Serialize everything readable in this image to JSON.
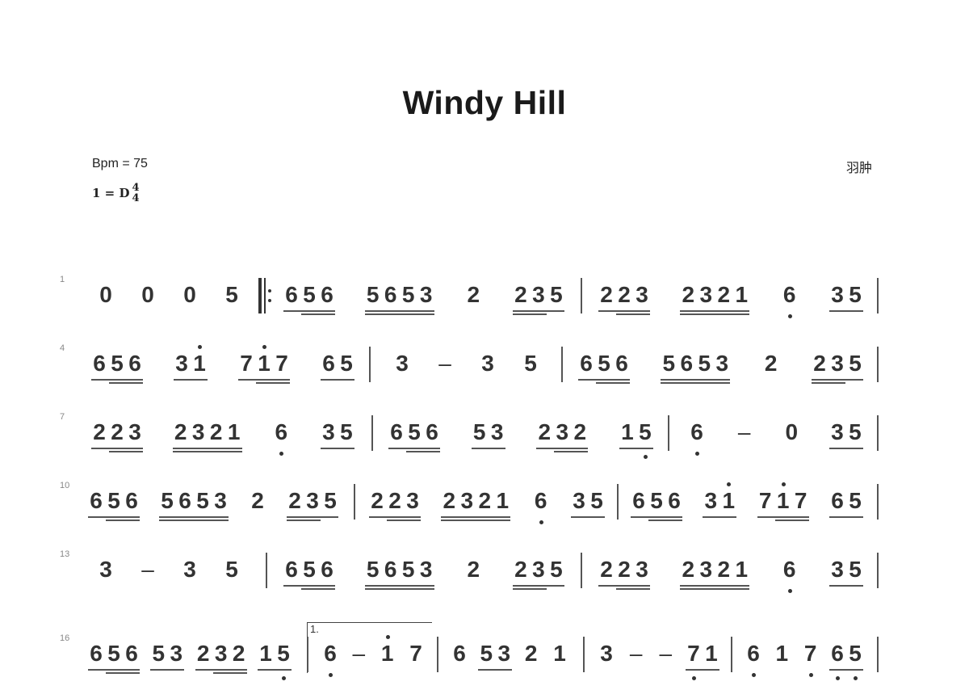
{
  "title": "Windy Hill",
  "bpm_label": "Bpm = 75",
  "key": {
    "prefix": "1 = D",
    "time_top": "4",
    "time_bottom": "4"
  },
  "composer": "羽肿",
  "rows": [
    {
      "measure_number": "1",
      "measures": [
        {
          "groups": [
            [
              {
                "n": "0"
              }
            ],
            [
              {
                "n": "0"
              }
            ],
            [
              {
                "n": "0"
              }
            ],
            [
              {
                "n": "5"
              }
            ]
          ],
          "end": "repeat-start"
        },
        {
          "groups": [
            [
              {
                "n": "6",
                "u": 1
              },
              {
                "n": "5",
                "u": 2
              },
              {
                "n": "6",
                "u": 2
              }
            ],
            [
              {
                "n": "5",
                "u": 2
              },
              {
                "n": "6",
                "u": 2
              },
              {
                "n": "5",
                "u": 2
              },
              {
                "n": "3",
                "u": 2
              }
            ],
            [
              {
                "n": "2"
              }
            ],
            [
              {
                "n": "2",
                "u": 2
              },
              {
                "n": "3",
                "u": 2
              },
              {
                "n": "5",
                "u": 1
              }
            ]
          ],
          "end": "bar"
        },
        {
          "groups": [
            [
              {
                "n": "2",
                "u": 1
              },
              {
                "n": "2",
                "u": 2
              },
              {
                "n": "3",
                "u": 2
              }
            ],
            [
              {
                "n": "2",
                "u": 2
              },
              {
                "n": "3",
                "u": 2
              },
              {
                "n": "2",
                "u": 2
              },
              {
                "n": "1",
                "u": 2
              }
            ],
            [
              {
                "n": "6",
                "dn": true
              }
            ],
            [
              {
                "n": "3",
                "u": 1
              },
              {
                "n": "5",
                "u": 1
              }
            ]
          ],
          "end": "bar"
        }
      ]
    },
    {
      "measure_number": "4",
      "measures": [
        {
          "groups": [
            [
              {
                "n": "6",
                "u": 1
              },
              {
                "n": "5",
                "u": 2
              },
              {
                "n": "6",
                "u": 2
              }
            ],
            [
              {
                "n": "3",
                "u": 1
              },
              {
                "n": "1",
                "u": 1,
                "up": true
              }
            ],
            [
              {
                "n": "7",
                "u": 1
              },
              {
                "n": "1",
                "u": 2,
                "up": true
              },
              {
                "n": "7",
                "u": 2
              }
            ],
            [
              {
                "n": "6",
                "u": 1
              },
              {
                "n": "5",
                "u": 1
              }
            ]
          ],
          "end": "bar"
        },
        {
          "groups": [
            [
              {
                "n": "3"
              }
            ],
            [
              {
                "n": "–"
              }
            ],
            [
              {
                "n": "3"
              }
            ],
            [
              {
                "n": "5"
              }
            ]
          ],
          "end": "bar"
        },
        {
          "groups": [
            [
              {
                "n": "6",
                "u": 1
              },
              {
                "n": "5",
                "u": 2
              },
              {
                "n": "6",
                "u": 2
              }
            ],
            [
              {
                "n": "5",
                "u": 2
              },
              {
                "n": "6",
                "u": 2
              },
              {
                "n": "5",
                "u": 2
              },
              {
                "n": "3",
                "u": 2
              }
            ],
            [
              {
                "n": "2"
              }
            ],
            [
              {
                "n": "2",
                "u": 2
              },
              {
                "n": "3",
                "u": 2
              },
              {
                "n": "5",
                "u": 1
              }
            ]
          ],
          "end": "bar"
        }
      ]
    },
    {
      "measure_number": "7",
      "measures": [
        {
          "groups": [
            [
              {
                "n": "2",
                "u": 1
              },
              {
                "n": "2",
                "u": 2
              },
              {
                "n": "3",
                "u": 2
              }
            ],
            [
              {
                "n": "2",
                "u": 2
              },
              {
                "n": "3",
                "u": 2
              },
              {
                "n": "2",
                "u": 2
              },
              {
                "n": "1",
                "u": 2
              }
            ],
            [
              {
                "n": "6",
                "dn": true
              }
            ],
            [
              {
                "n": "3",
                "u": 1
              },
              {
                "n": "5",
                "u": 1
              }
            ]
          ],
          "end": "bar"
        },
        {
          "groups": [
            [
              {
                "n": "6",
                "u": 1
              },
              {
                "n": "5",
                "u": 2
              },
              {
                "n": "6",
                "u": 2
              }
            ],
            [
              {
                "n": "5",
                "u": 1
              },
              {
                "n": "3",
                "u": 1
              }
            ],
            [
              {
                "n": "2",
                "u": 1
              },
              {
                "n": "3",
                "u": 2
              },
              {
                "n": "2",
                "u": 2
              }
            ],
            [
              {
                "n": "1",
                "u": 1
              },
              {
                "n": "5",
                "u": 1,
                "dn": true
              }
            ]
          ],
          "end": "bar"
        },
        {
          "groups": [
            [
              {
                "n": "6",
                "dn": true
              }
            ],
            [
              {
                "n": "–"
              }
            ],
            [
              {
                "n": "0"
              }
            ],
            [
              {
                "n": "3",
                "u": 1
              },
              {
                "n": "5",
                "u": 1
              }
            ]
          ],
          "end": "bar"
        }
      ]
    },
    {
      "measure_number": "10",
      "measures": [
        {
          "groups": [
            [
              {
                "n": "6",
                "u": 1
              },
              {
                "n": "5",
                "u": 2
              },
              {
                "n": "6",
                "u": 2
              }
            ],
            [
              {
                "n": "5",
                "u": 2
              },
              {
                "n": "6",
                "u": 2
              },
              {
                "n": "5",
                "u": 2
              },
              {
                "n": "3",
                "u": 2
              }
            ],
            [
              {
                "n": "2"
              }
            ],
            [
              {
                "n": "2",
                "u": 2
              },
              {
                "n": "3",
                "u": 2
              },
              {
                "n": "5",
                "u": 1
              }
            ]
          ],
          "end": "bar"
        },
        {
          "groups": [
            [
              {
                "n": "2",
                "u": 1
              },
              {
                "n": "2",
                "u": 2
              },
              {
                "n": "3",
                "u": 2
              }
            ],
            [
              {
                "n": "2",
                "u": 2
              },
              {
                "n": "3",
                "u": 2
              },
              {
                "n": "2",
                "u": 2
              },
              {
                "n": "1",
                "u": 2
              }
            ],
            [
              {
                "n": "6",
                "dn": true
              }
            ],
            [
              {
                "n": "3",
                "u": 1
              },
              {
                "n": "5",
                "u": 1
              }
            ]
          ],
          "end": "bar"
        },
        {
          "groups": [
            [
              {
                "n": "6",
                "u": 1
              },
              {
                "n": "5",
                "u": 2
              },
              {
                "n": "6",
                "u": 2
              }
            ],
            [
              {
                "n": "3",
                "u": 1
              },
              {
                "n": "1",
                "u": 1,
                "up": true
              }
            ],
            [
              {
                "n": "7",
                "u": 1
              },
              {
                "n": "1",
                "u": 2,
                "up": true
              },
              {
                "n": "7",
                "u": 2
              }
            ],
            [
              {
                "n": "6",
                "u": 1
              },
              {
                "n": "5",
                "u": 1
              }
            ]
          ],
          "end": "bar"
        }
      ]
    },
    {
      "measure_number": "13",
      "measures": [
        {
          "groups": [
            [
              {
                "n": "3"
              }
            ],
            [
              {
                "n": "–"
              }
            ],
            [
              {
                "n": "3"
              }
            ],
            [
              {
                "n": "5"
              }
            ]
          ],
          "end": "bar"
        },
        {
          "groups": [
            [
              {
                "n": "6",
                "u": 1
              },
              {
                "n": "5",
                "u": 2
              },
              {
                "n": "6",
                "u": 2
              }
            ],
            [
              {
                "n": "5",
                "u": 2
              },
              {
                "n": "6",
                "u": 2
              },
              {
                "n": "5",
                "u": 2
              },
              {
                "n": "3",
                "u": 2
              }
            ],
            [
              {
                "n": "2"
              }
            ],
            [
              {
                "n": "2",
                "u": 2
              },
              {
                "n": "3",
                "u": 2
              },
              {
                "n": "5",
                "u": 1
              }
            ]
          ],
          "end": "bar"
        },
        {
          "groups": [
            [
              {
                "n": "2",
                "u": 1
              },
              {
                "n": "2",
                "u": 2
              },
              {
                "n": "3",
                "u": 2
              }
            ],
            [
              {
                "n": "2",
                "u": 2
              },
              {
                "n": "3",
                "u": 2
              },
              {
                "n": "2",
                "u": 2
              },
              {
                "n": "1",
                "u": 2
              }
            ],
            [
              {
                "n": "6",
                "dn": true
              }
            ],
            [
              {
                "n": "3",
                "u": 1
              },
              {
                "n": "5",
                "u": 1
              }
            ]
          ],
          "end": "bar"
        }
      ]
    },
    {
      "measure_number": "16",
      "volta_label": "1.",
      "measures": [
        {
          "groups": [
            [
              {
                "n": "6",
                "u": 1
              },
              {
                "n": "5",
                "u": 2
              },
              {
                "n": "6",
                "u": 2
              }
            ],
            [
              {
                "n": "5",
                "u": 1
              },
              {
                "n": "3",
                "u": 1
              }
            ],
            [
              {
                "n": "2",
                "u": 1
              },
              {
                "n": "3",
                "u": 2
              },
              {
                "n": "2",
                "u": 2
              }
            ],
            [
              {
                "n": "1",
                "u": 1
              },
              {
                "n": "5",
                "u": 1,
                "dn": true
              }
            ]
          ],
          "end": "bar"
        },
        {
          "groups": [
            [
              {
                "n": "6",
                "dn": true
              }
            ],
            [
              {
                "n": "–"
              }
            ],
            [
              {
                "n": "1",
                "up": true
              }
            ],
            [
              {
                "n": "7"
              }
            ]
          ],
          "end": "bar"
        },
        {
          "groups": [
            [
              {
                "n": "6"
              }
            ],
            [
              {
                "n": "5",
                "u": 1
              },
              {
                "n": "3",
                "u": 1
              }
            ],
            [
              {
                "n": "2"
              }
            ],
            [
              {
                "n": "1"
              }
            ]
          ],
          "end": "bar"
        },
        {
          "groups": [
            [
              {
                "n": "3"
              }
            ],
            [
              {
                "n": "–"
              }
            ],
            [
              {
                "n": "–"
              }
            ],
            [
              {
                "n": "7",
                "u": 1,
                "dn": true
              },
              {
                "n": "1",
                "u": 1
              }
            ]
          ],
          "end": "bar"
        },
        {
          "groups": [
            [
              {
                "n": "6",
                "dn": true
              }
            ],
            [
              {
                "n": "1"
              }
            ],
            [
              {
                "n": "7",
                "dn": true
              }
            ],
            [
              {
                "n": "6",
                "u": 1,
                "dn": true
              },
              {
                "n": "5",
                "u": 1,
                "dn": true
              }
            ]
          ],
          "end": "bar"
        }
      ]
    }
  ]
}
